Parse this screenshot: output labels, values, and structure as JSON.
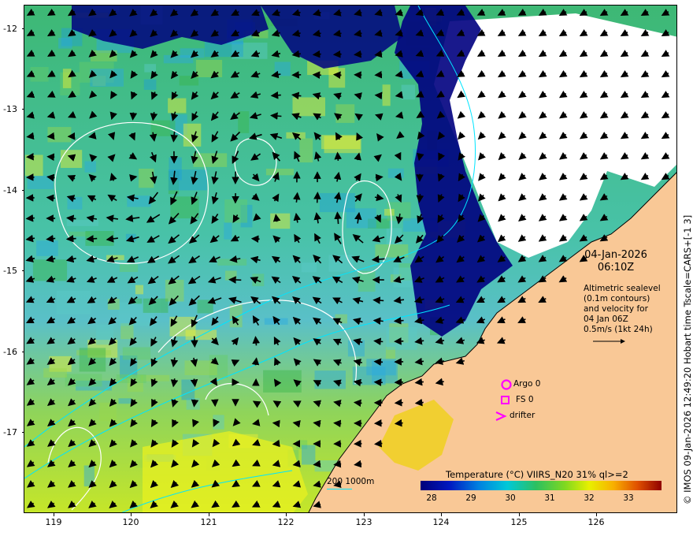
{
  "map": {
    "y_ticks": [
      "-12",
      "-13",
      "-14",
      "-15",
      "-16",
      "-17"
    ],
    "x_ticks": [
      "119",
      "120",
      "121",
      "122",
      "123",
      "124",
      "125",
      "126"
    ],
    "lat_range": [
      -17.95,
      -11.6
    ],
    "lon_range": [
      118.6,
      126.9
    ]
  },
  "annotation": {
    "date": "04-Jan-2026",
    "time": "06:10Z",
    "note_lines": [
      "Altimetric sealevel",
      "(0.1m contours)",
      "and velocity for",
      "04 Jan 06Z",
      "0.5m/s (1kt 24h)"
    ]
  },
  "legend": {
    "argo": "Argo 0",
    "fs": "FS 0",
    "drifter": "drifter",
    "marker_color": "#ff00ff"
  },
  "colorbar": {
    "title": "Temperature (°C) VIIRS_N20 31% ql>=2",
    "ticks": [
      "28",
      "29",
      "30",
      "31",
      "32",
      "33"
    ],
    "range": [
      27.7,
      33.9
    ]
  },
  "depth": {
    "label": "200  1000m",
    "color": "#00e5ff"
  },
  "credit": "© IMOS 09-Jan-2026 12:49:20 Hobart time Tscale=CARS+[-1 3]",
  "colors": {
    "land": "#f9c896",
    "cloud": "#ffffff",
    "cold": "#000080",
    "sst_mid": "#3cb878",
    "warm": "#ffff00"
  }
}
